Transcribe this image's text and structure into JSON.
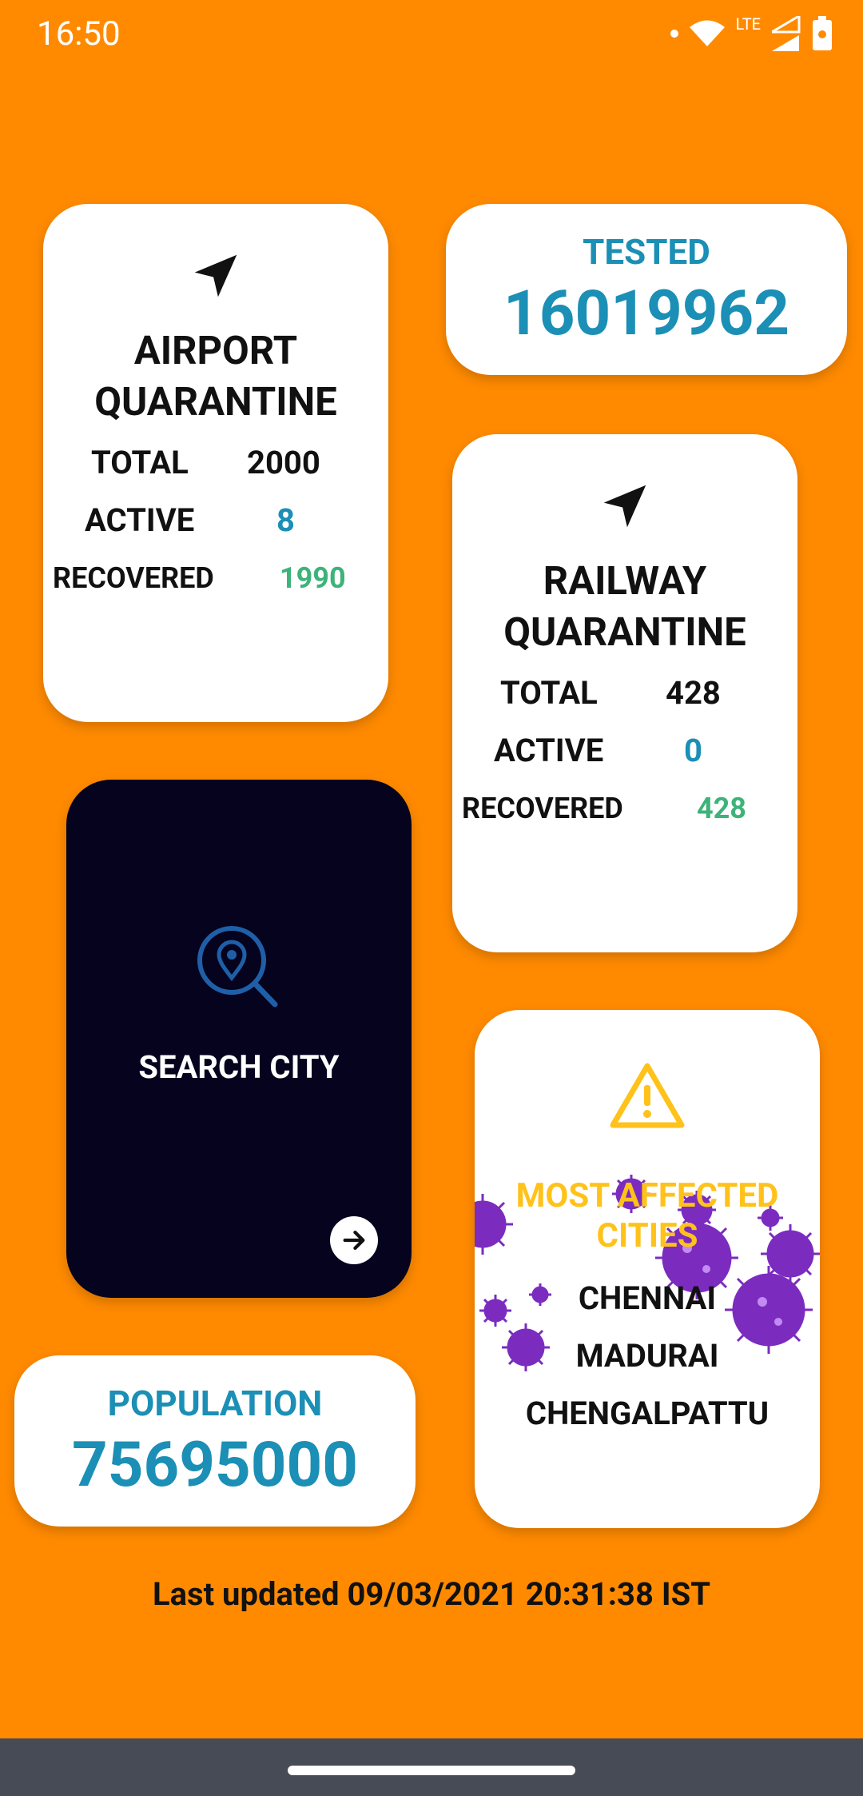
{
  "status_bar": {
    "time": "16:50",
    "network": "LTE",
    "icons": [
      "dot-icon",
      "wifi-icon",
      "signal-icon",
      "battery-icon"
    ]
  },
  "airport": {
    "icon": "navigation-icon",
    "title_line1": "AIRPORT",
    "title_line2": "QUARANTINE",
    "total_label": "TOTAL",
    "total_value": "2000",
    "active_label": "ACTIVE",
    "active_value": "8",
    "recovered_label": "RECOVERED",
    "recovered_value": "1990"
  },
  "tested": {
    "label": "TESTED",
    "value": "16019962"
  },
  "railway": {
    "icon": "navigation-icon",
    "title_line1": "RAILWAY",
    "title_line2": "QUARANTINE",
    "total_label": "TOTAL",
    "total_value": "428",
    "active_label": "ACTIVE",
    "active_value": "0",
    "recovered_label": "RECOVERED",
    "recovered_value": "428"
  },
  "search": {
    "icon": "location-search-icon",
    "label": "SEARCH CITY",
    "arrow_icon": "arrow-right-icon"
  },
  "affected": {
    "icon": "warning-icon",
    "title_line1": "MOST AFFECTED",
    "title_line2": "CITIES",
    "cities": [
      "CHENNAI",
      "MADURAI",
      "CHENGALPATTU"
    ]
  },
  "population": {
    "label": "POPULATION",
    "value": "75695000"
  },
  "footer": {
    "last_updated": "Last updated 09/03/2021 20:31:38 IST"
  },
  "colors": {
    "background": "#FF8A00",
    "accent_blue": "#1B8FB5",
    "accent_green": "#3DB37A",
    "warning_yellow": "#FFC21A",
    "search_card": "#05031E",
    "virus_purple": "#7B2CBF"
  }
}
